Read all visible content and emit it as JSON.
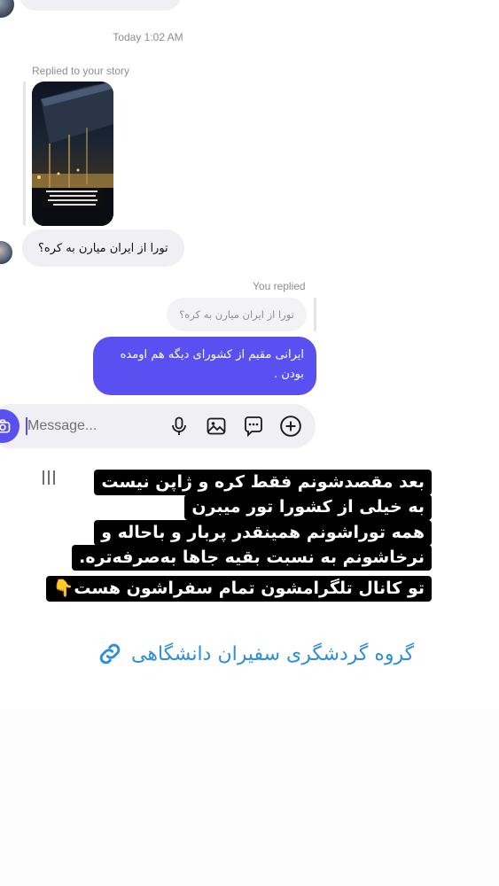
{
  "chat": {
    "timestamp": "Today 1:02 AM",
    "replied_story_label": "Replied to your story",
    "story_caption_lines": [
      "از ایران تورهای کره و ژاپن",
      "ترکیه، گرجستان و چین",
      "اروپا و آمریکا برگزار میکنند",
      "برای اطلاعات بیشتر تماس بگیرید"
    ],
    "incoming_message": "تورا از ایران میارن به کره؟",
    "you_replied_label": "You replied",
    "quoted_message": "تورا از ایران میارن به کره؟",
    "outgoing_message": "ایرانی مقیم از کشورای دیگه هم اومده بودن ."
  },
  "composer": {
    "placeholder": "Message...",
    "icons": [
      "camera-icon",
      "microphone-icon",
      "gallery-icon",
      "sticker-icon",
      "add-icon"
    ]
  },
  "overlay": {
    "lines": [
      "بعد مقصدشونم فقط کره و ژاپن نیست",
      "به خیلی از کشورا تور میبرن",
      "همه توراشونم همینقدر پربار و باحاله و",
      "نرخاشونم به نسبت بقیه جاها به‌صرفه‌تره.",
      "تو کانال تلگرامشون تمام سفراشون هست👇"
    ]
  },
  "link": {
    "text": "گروه گردشگری سفیران دانشگاهی",
    "color": "#2e8fd8"
  },
  "colors": {
    "accent": "#5a4ff0",
    "incoming_bubble": "#efeff4",
    "secondary_text": "#8e8e93"
  }
}
